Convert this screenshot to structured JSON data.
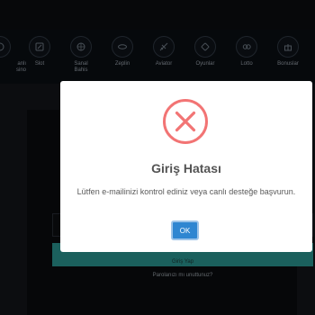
{
  "nav": {
    "items": [
      {
        "label": "anlı\nsino",
        "icon": "live-casino-icon"
      },
      {
        "label": "Slot",
        "icon": "slot-icon"
      },
      {
        "label": "Sanal\nBahis",
        "icon": "virtual-betting-icon"
      },
      {
        "label": "Zeplin",
        "icon": "zeppelin-icon"
      },
      {
        "label": "Aviator",
        "icon": "airplane-icon"
      },
      {
        "label": "Oyunlar",
        "icon": "games-icon"
      },
      {
        "label": "Lotto",
        "icon": "lotto-icon"
      },
      {
        "label": "Bonuslar",
        "icon": "gift-icon"
      }
    ]
  },
  "login": {
    "button_label": "Giriş Yap",
    "forgot_link": "Parolanızı mı unuttunuz?"
  },
  "modal": {
    "title": "Giriş Hatası",
    "message": "Lütfen e-mailinizi kontrol ediniz veya canlı desteğe başvurun.",
    "ok_label": "OK",
    "icon": "error-x-icon",
    "icon_color": "#f27474"
  }
}
